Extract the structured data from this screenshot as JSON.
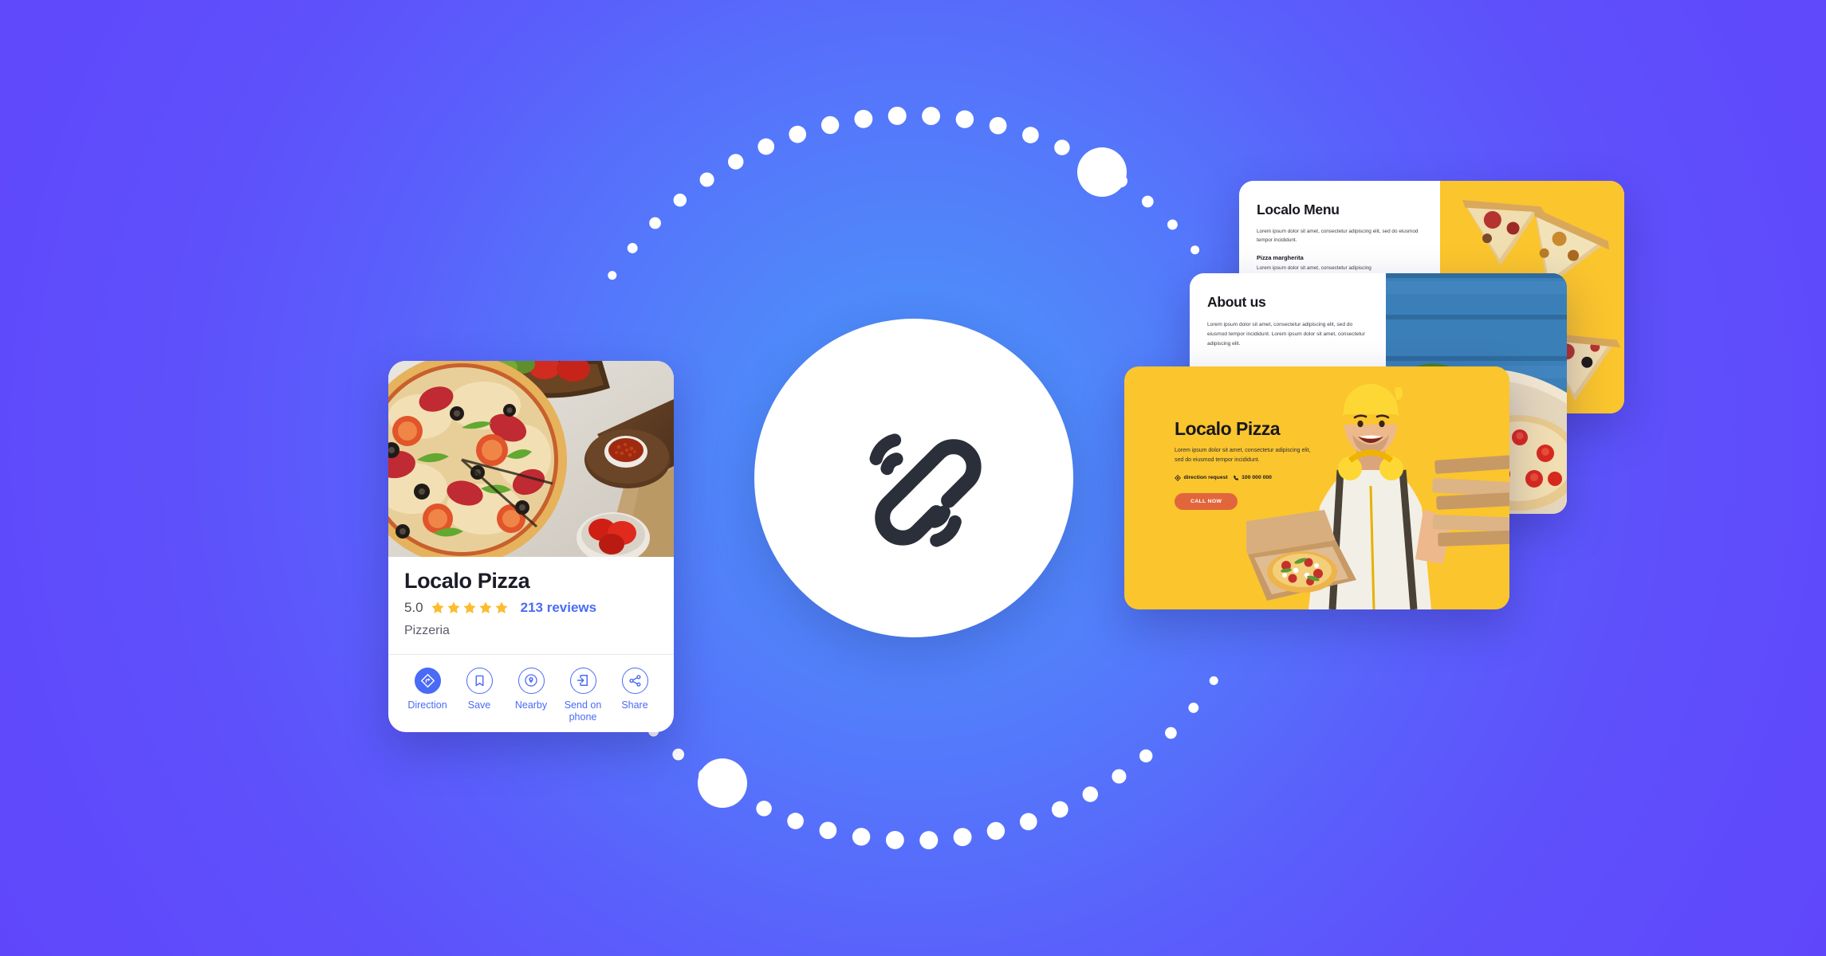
{
  "theme": {
    "bg_center": "#4f8afa",
    "bg_edge": "#6046fb",
    "accent_blue": "#4a6bf5",
    "accent_yellow": "#fbc52d",
    "accent_orange": "#e2653c",
    "star_gold": "#fcbc2d",
    "ink": "#17181f"
  },
  "center_badge": {
    "icon": "chain-link-icon",
    "icon_color": "#2b2f3a",
    "circle_color": "#ffffff"
  },
  "orbit": {
    "dot_color": "#ffffff",
    "top_arc_dots": 21,
    "bottom_arc_dots": 21,
    "large_dot_top_right": true,
    "large_dot_bottom_left": true
  },
  "business_card": {
    "photo_alt": "pizza-platter-photo",
    "title": "Localo Pizza",
    "rating": "5.0",
    "stars": 5,
    "reviews": "213 reviews",
    "category": "Pizzeria",
    "actions": [
      {
        "label": "Direction",
        "icon": "direction-arrow-icon",
        "primary": true
      },
      {
        "label": "Save",
        "icon": "bookmark-icon",
        "primary": false
      },
      {
        "label": "Nearby",
        "icon": "map-pin-icon",
        "primary": false
      },
      {
        "label": "Send on phone",
        "icon": "send-to-device-icon",
        "primary": false
      },
      {
        "label": "Share",
        "icon": "share-nodes-icon",
        "primary": false
      }
    ]
  },
  "menu_card": {
    "title": "Localo Menu",
    "paragraph": "Lorem ipsum dolor sit amet, consectetur adipiscing elit, sed do eiusmod tempor incididunt.",
    "item_title": "Pizza margherita",
    "item_paragraph": "Lorem ipsum dolor sit amet, consectetur adipiscing",
    "photo_alt": "pizza-slices-on-yellow-photo",
    "panel_color": "#fbc52d"
  },
  "about_card": {
    "title": "About us",
    "paragraph": "Lorem ipsum dolor sit amet, consectetur adipiscing elit, sed do eiusmod tempor incididunt. Lorem ipsum dolor sit amet, consectetur adipiscing elit.",
    "photo_alt": "pizza-with-tomatoes-on-blue-wood-photo"
  },
  "hero_card": {
    "title": "Localo Pizza",
    "paragraph": "Lorem ipsum dolor sit amet, consectetur adipiscing elit, sed do eiusmod tempor incididunt.",
    "direction_label": "direction request",
    "direction_icon": "direction-diamond-icon",
    "phone_number": "100 000 000",
    "phone_icon": "phone-icon",
    "cta_label": "CALL NOW",
    "photo_alt": "man-with-yellow-beanie-holding-pizza-boxes-photo",
    "bg_color": "#fbc52d"
  }
}
